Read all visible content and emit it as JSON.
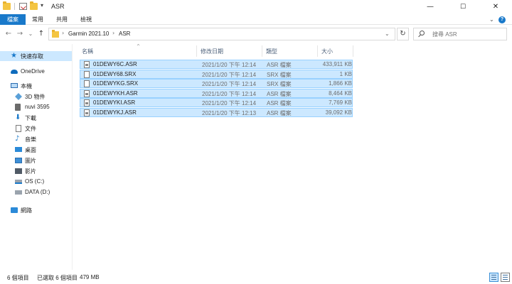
{
  "window": {
    "title": "ASR",
    "minimize": "—",
    "maximize": "☐",
    "close": "✕"
  },
  "ribbon": {
    "tabs": [
      "檔案",
      "常用",
      "共用",
      "檢視"
    ],
    "collapse": "⌄"
  },
  "address": {
    "back": "←",
    "forward": "→",
    "history": "⌄",
    "up": "↑",
    "crumbs": [
      "Garmin 2021.10",
      "ASR"
    ],
    "separator": "›",
    "dropdown": "⌄",
    "refresh": "↻"
  },
  "search": {
    "placeholder": "搜尋 ASR"
  },
  "nav": {
    "items": [
      {
        "label": "快速存取",
        "icon": "star-icon"
      },
      {
        "label": "OneDrive",
        "icon": "cloud-icon"
      },
      {
        "label": "本機",
        "icon": "pc-icon"
      },
      {
        "label": "3D 物件",
        "icon": "cube-icon"
      },
      {
        "label": "nuvi 3595",
        "icon": "device-icon"
      },
      {
        "label": "下載",
        "icon": "download-icon"
      },
      {
        "label": "文件",
        "icon": "document-icon"
      },
      {
        "label": "音樂",
        "icon": "music-icon"
      },
      {
        "label": "桌面",
        "icon": "desktop-icon"
      },
      {
        "label": "圖片",
        "icon": "pictures-icon"
      },
      {
        "label": "影片",
        "icon": "video-icon"
      },
      {
        "label": "OS (C:)",
        "icon": "os-drive-icon"
      },
      {
        "label": "DATA (D:)",
        "icon": "drive-icon"
      },
      {
        "label": "網路",
        "icon": "network-icon"
      }
    ]
  },
  "columns": {
    "name": "名稱",
    "modified": "修改日期",
    "type": "類型",
    "size": "大小",
    "sort_indicator": "^"
  },
  "files": [
    {
      "name": "01DEWY6C.ASR",
      "modified": "2021/1/20 下午 12:14",
      "type": "ASR 檔案",
      "size": "433,911 KB",
      "kind": "asr"
    },
    {
      "name": "01DEWY68.SRX",
      "modified": "2021/1/20 下午 12:14",
      "type": "SRX 檔案",
      "size": "1 KB",
      "kind": "srx"
    },
    {
      "name": "01DEWYKG.SRX",
      "modified": "2021/1/20 下午 12:14",
      "type": "SRX 檔案",
      "size": "1,866 KB",
      "kind": "srx"
    },
    {
      "name": "01DEWYKH.ASR",
      "modified": "2021/1/20 下午 12:14",
      "type": "ASR 檔案",
      "size": "8,464 KB",
      "kind": "asr"
    },
    {
      "name": "01DEWYKI.ASR",
      "modified": "2021/1/20 下午 12:14",
      "type": "ASR 檔案",
      "size": "7,769 KB",
      "kind": "asr"
    },
    {
      "name": "01DEWYKJ.ASR",
      "modified": "2021/1/20 下午 12:13",
      "type": "ASR 檔案",
      "size": "39,092 KB",
      "kind": "asr"
    }
  ],
  "status": {
    "count": "6 個項目",
    "selected": "已選取 6 個項目",
    "size": "479 MB"
  },
  "colors": {
    "accent": "#1979ca",
    "selection": "#cce8ff",
    "selection_border": "#99d1ff"
  }
}
